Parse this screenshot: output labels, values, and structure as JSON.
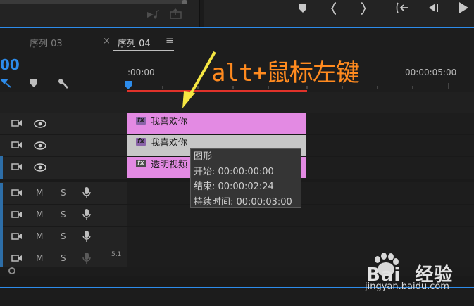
{
  "top_controls": {
    "left_icons": [
      "music-note-icon",
      "export-frame-icon"
    ],
    "right_icons": [
      "marker-icon",
      "mark-in-icon",
      "mark-out-icon",
      "go-to-in-icon",
      "step-back-icon",
      "play-icon"
    ]
  },
  "tabs": [
    {
      "label": "序列 03",
      "active": false
    },
    {
      "label": "序列 04",
      "active": true
    }
  ],
  "tab_close": "×",
  "tab_menu": "≡",
  "timecode_partial": "00",
  "ruler": {
    "start_label": ":00:00",
    "end_label": "00:00:05:00"
  },
  "annotation": "alt+鼠标左键",
  "video_tracks": [
    {
      "clip_label": "我喜欢你",
      "clip_color": "#e38ae3"
    },
    {
      "clip_label": "我喜欢你",
      "clip_color": "#c7c7c7"
    },
    {
      "clip_label": "透明视频",
      "clip_color": "#e38ae3"
    }
  ],
  "audio_tracks": [
    {
      "m": "M",
      "s": "S"
    },
    {
      "m": "M",
      "s": "S"
    },
    {
      "m": "M",
      "s": "S"
    },
    {
      "m": "M",
      "s": "S",
      "extra": "5.1"
    }
  ],
  "tooltip": {
    "title": "图形",
    "start": "开始: 00:00:00:00",
    "end": "结束: 00:00:02:24",
    "duration": "持续时间: 00:00:03:00"
  },
  "fx_label": "fx",
  "watermark": {
    "brand": "Bai  经验",
    "url": "jingyan.baidu.com"
  },
  "colors": {
    "accent": "#2d8ceb",
    "playhead": "#2d8ceb",
    "work_area": "#e0322a",
    "annotation": "#ff8a1f",
    "arrow": "#f5e642"
  }
}
